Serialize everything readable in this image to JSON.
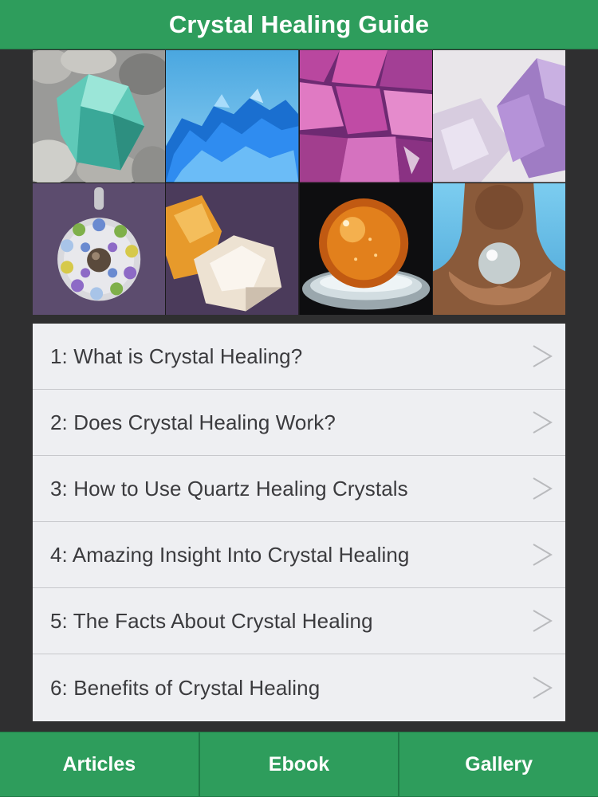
{
  "header": {
    "title": "Crystal Healing Guide"
  },
  "gallery": {
    "images": [
      "aqua-glass-crystal-on-stones",
      "blue-crystal-cluster",
      "pink-purple-amethyst-cluster",
      "light-amethyst-point",
      "gemstone-pendant",
      "citrine-and-quartz-stones",
      "amber-crystal-ball-on-glass-stand",
      "hands-holding-crystal-ball"
    ]
  },
  "menu": {
    "items": [
      {
        "label": "1: What is Crystal Healing?"
      },
      {
        "label": "2: Does Crystal Healing Work?"
      },
      {
        "label": "3: How to Use Quartz Healing Crystals"
      },
      {
        "label": "4: Amazing Insight Into Crystal Healing"
      },
      {
        "label": "5: The Facts About Crystal Healing"
      },
      {
        "label": "6: Benefits of Crystal Healing"
      }
    ],
    "chevron_icon": "chevron-right-icon"
  },
  "tabbar": {
    "tabs": [
      {
        "label": "Articles"
      },
      {
        "label": "Ebook"
      },
      {
        "label": "Gallery"
      }
    ]
  },
  "colors": {
    "accent": "#2e9d5c",
    "background": "#2f2f30",
    "list_background": "#eeeff2",
    "list_text": "#3b3b3e"
  }
}
